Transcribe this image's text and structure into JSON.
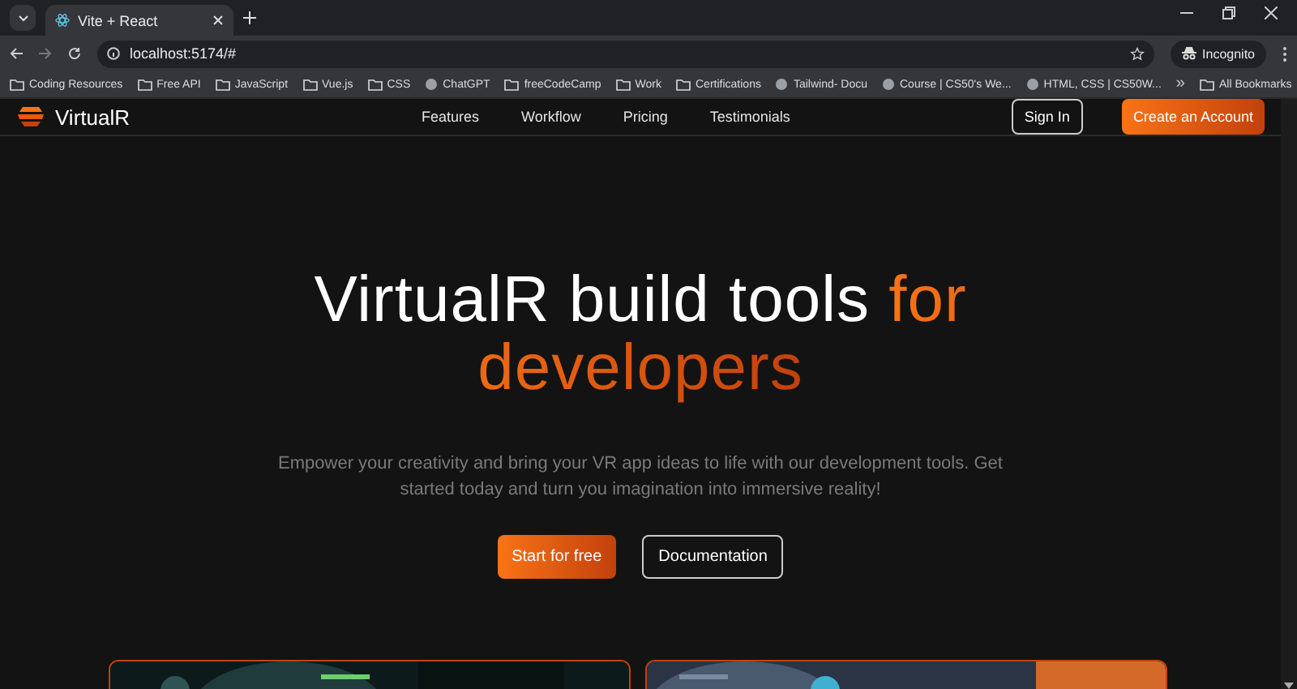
{
  "browser": {
    "tab": {
      "title": "Vite + React"
    },
    "address": "localhost:5174/#",
    "profile": "Incognito",
    "bookmarks": [
      {
        "label": "Coding Resources",
        "kind": "folder"
      },
      {
        "label": "Free API",
        "kind": "folder"
      },
      {
        "label": "JavaScript",
        "kind": "folder"
      },
      {
        "label": "Vue.js",
        "kind": "folder"
      },
      {
        "label": "CSS",
        "kind": "folder"
      },
      {
        "label": "ChatGPT",
        "kind": "site"
      },
      {
        "label": "freeCodeCamp",
        "kind": "folder"
      },
      {
        "label": "Work",
        "kind": "folder"
      },
      {
        "label": "Certifications",
        "kind": "folder"
      },
      {
        "label": "Tailwind- Docu",
        "kind": "site"
      },
      {
        "label": "Course | CS50's We...",
        "kind": "site"
      },
      {
        "label": "HTML, CSS | CS50W...",
        "kind": "site"
      }
    ],
    "more": "»",
    "all_bookmarks": "All Bookmarks"
  },
  "navbar": {
    "brand": "VirtualR",
    "links": [
      "Features",
      "Workflow",
      "Pricing",
      "Testimonials"
    ],
    "sign_in": "Sign In",
    "cta": "Create an Account"
  },
  "hero": {
    "title": "VirtualR build tools",
    "title_accent": "for developers",
    "subtitle": "Empower your creativity and bring your VR app ideas to life with our development tools. Get started today and turn you imagination into immersive reality!",
    "primary": "Start for free",
    "secondary": "Documentation"
  }
}
